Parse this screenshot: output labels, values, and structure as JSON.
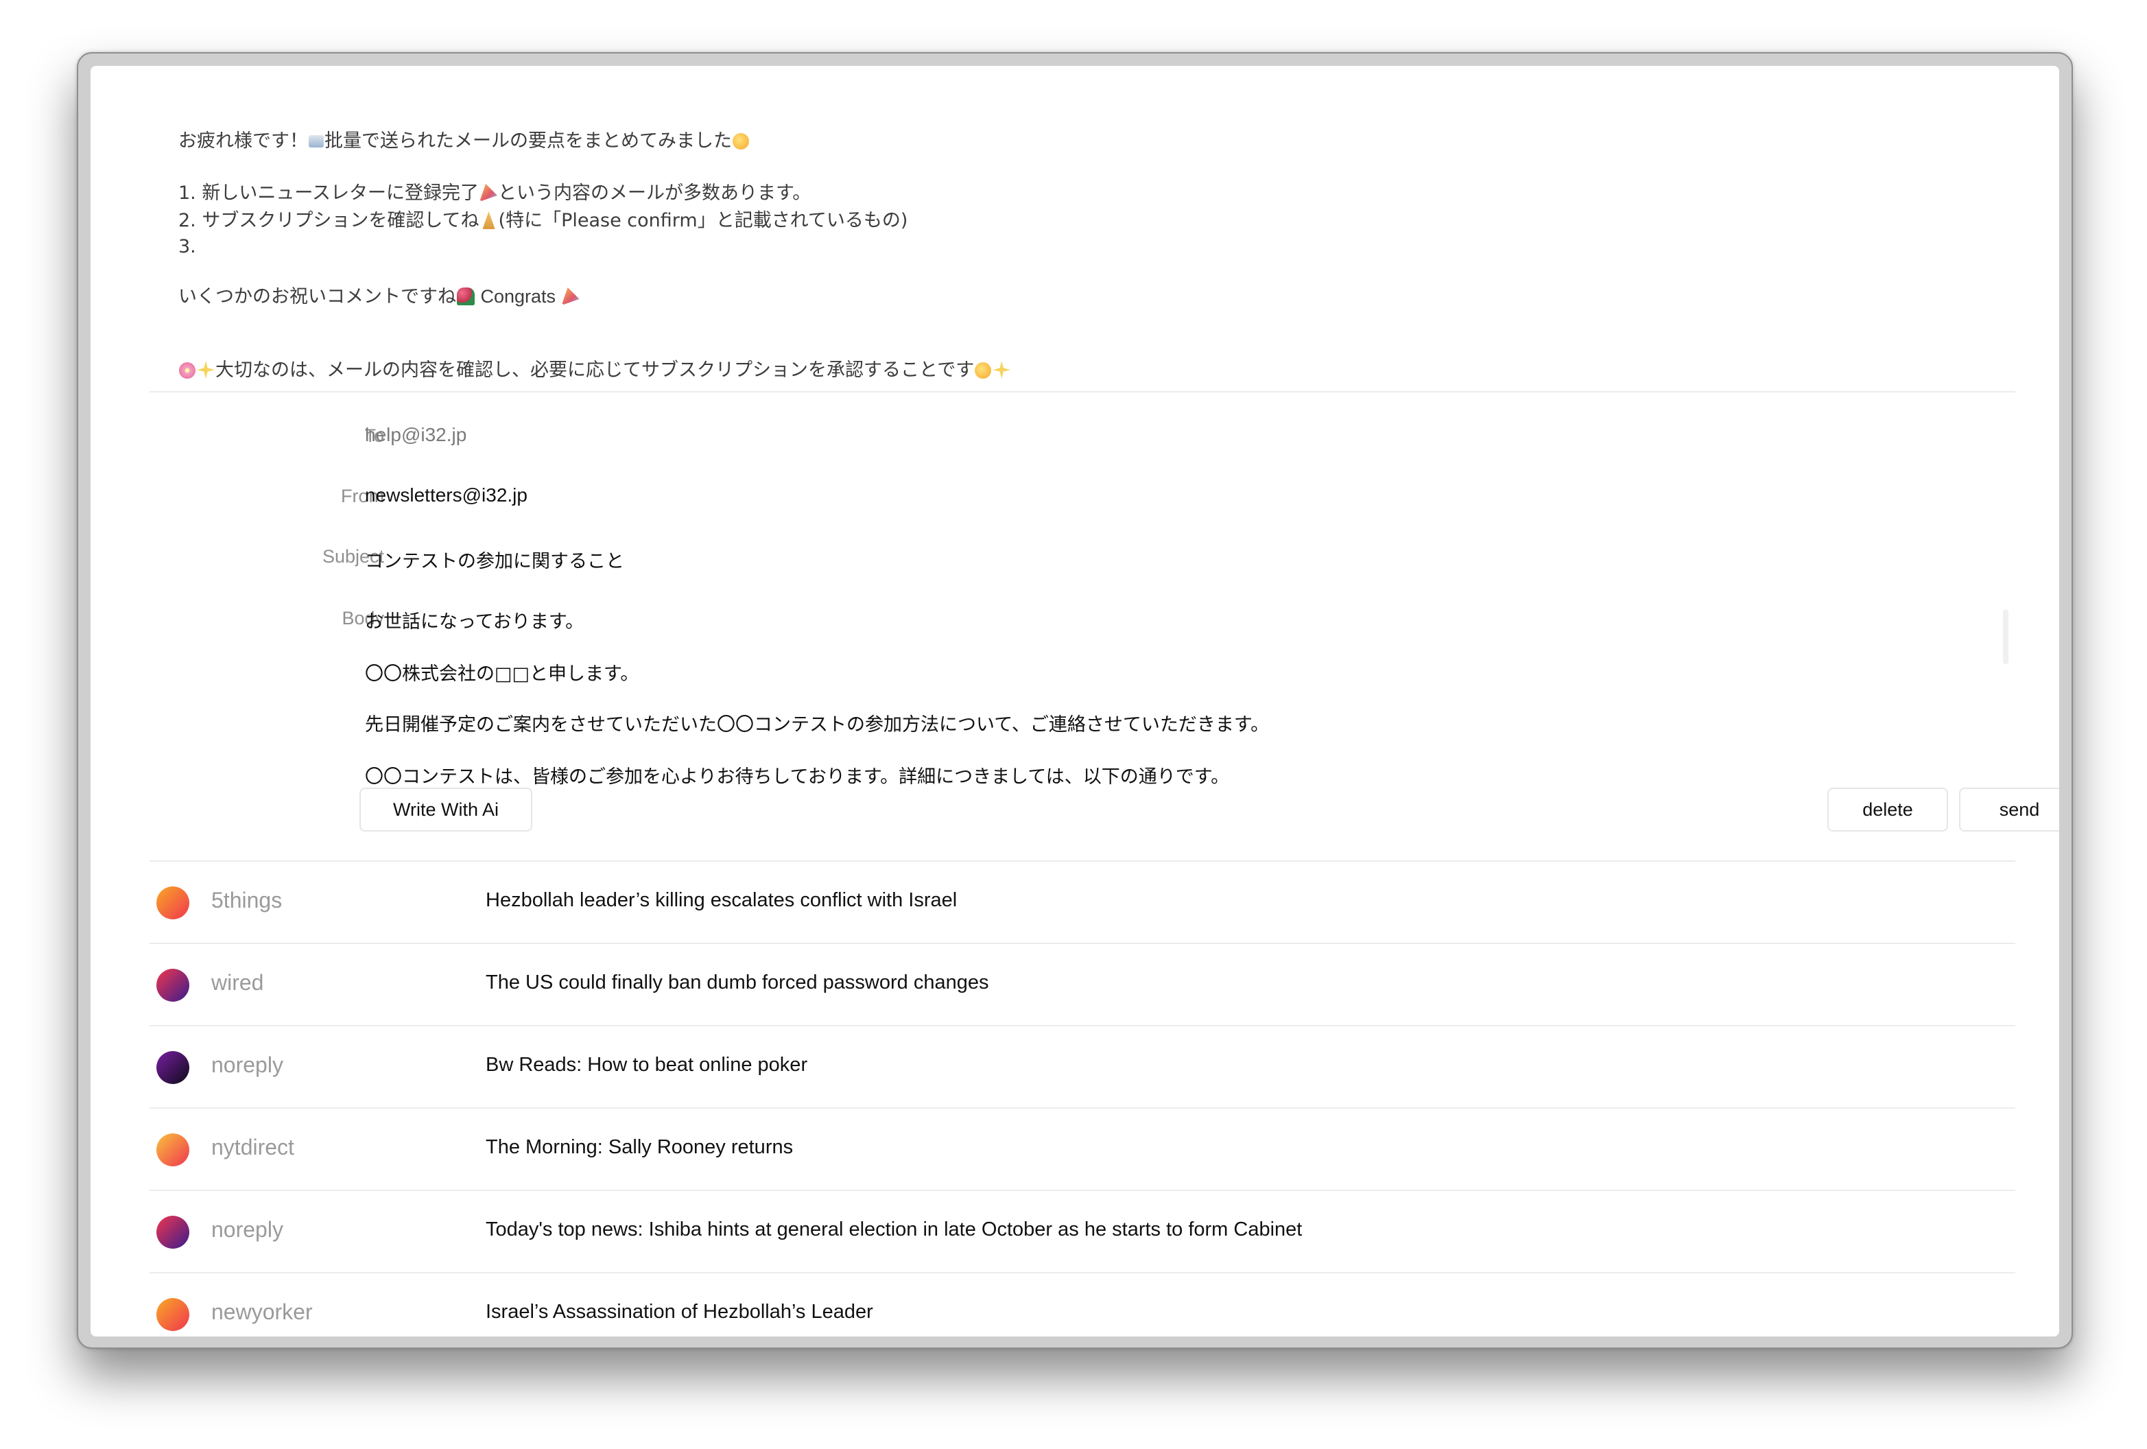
{
  "summary": {
    "greeting_a": "お疲れ様です！",
    "greeting_b": "批量で送られたメールの要点をまとめてみました",
    "item1_a": "1. 新しいニュースレターに登録完了",
    "item1_b": "という内容のメールが多数あります。",
    "item2_a": "2. サブスクリプションを確認してね",
    "item2_b": "(特に「Please confirm」と記載されているもの)",
    "item3": "3.",
    "congrats_a": "いくつかのお祝いコメントですね",
    "congrats_b": " Congrats ",
    "closing": "大切なのは、メールの内容を確認し、必要に応じてサブスクリプションを承認することです"
  },
  "compose": {
    "to_label": "To",
    "to_value": "help@i32.jp",
    "from_label": "From",
    "from_value": "newsletters@i32.jp",
    "subject_label": "Subject",
    "subject_value": "コンテストの参加に関すること",
    "body_label": "Body",
    "body_lines": [
      "お世話になっております。",
      "〇〇株式会社の□□と申します。",
      "先日開催予定のご案内をさせていただいた〇〇コンテストの参加方法について、ご連絡させていただきます。",
      "〇〇コンテストは、皆様のご参加を心よりお待ちしております。詳細につきましては、以下の通りです。"
    ],
    "write_ai_label": "Write With Ai",
    "delete_label": "delete",
    "send_label": "send"
  },
  "emails": [
    {
      "sender": "5things",
      "subject": "Hezbollah leader’s killing escalates conflict with Israel",
      "avatar_colors": [
        "#f0364f",
        "#f9a825"
      ]
    },
    {
      "sender": "wired",
      "subject": "The US could finally ban dumb forced password changes",
      "avatar_colors": [
        "#3b1c8c",
        "#f0364f"
      ]
    },
    {
      "sender": "noreply",
      "subject": "Bw Reads: How to beat online poker",
      "avatar_colors": [
        "#0d0a1a",
        "#7a1fa2"
      ]
    },
    {
      "sender": "nytdirect",
      "subject": "The Morning: Sally Rooney returns",
      "avatar_colors": [
        "#f0364f",
        "#f9c23c"
      ]
    },
    {
      "sender": "noreply",
      "subject": "Today's top news: Ishiba hints at general election in late October as he starts to form Cabinet",
      "avatar_colors": [
        "#3b1c8c",
        "#f0364f"
      ]
    },
    {
      "sender": "newyorker",
      "subject": "Israel’s Assassination of Hezbollah’s Leader",
      "avatar_colors": [
        "#f0364f",
        "#f9a825"
      ]
    }
  ]
}
